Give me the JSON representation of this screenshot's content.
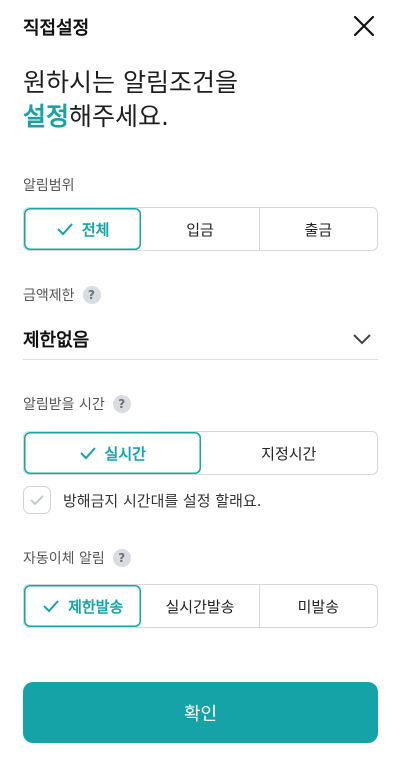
{
  "header": {
    "title": "직접설정"
  },
  "headline": {
    "line1": "원하시는 알림조건을",
    "accent": "설정",
    "line2_rest": "해주세요."
  },
  "alert_scope": {
    "label": "알림범위",
    "options": [
      {
        "label": "전체",
        "selected": true
      },
      {
        "label": "입금",
        "selected": false
      },
      {
        "label": "출금",
        "selected": false
      }
    ]
  },
  "amount_limit": {
    "label": "금액제한",
    "help": "?",
    "value": "제한없음"
  },
  "alert_time": {
    "label": "알림받을 시간",
    "help": "?",
    "options": [
      {
        "label": "실시간",
        "selected": true
      },
      {
        "label": "지정시간",
        "selected": false
      }
    ]
  },
  "do_not_disturb": {
    "label": "방해금지 시간대를 설정 할래요.",
    "checked": false
  },
  "auto_transfer": {
    "label": "자동이체 알림",
    "help": "?",
    "options": [
      {
        "label": "제한발송",
        "selected": true
      },
      {
        "label": "실시간발송",
        "selected": false
      },
      {
        "label": "미발송",
        "selected": false
      }
    ]
  },
  "confirm": {
    "label": "확인"
  },
  "colors": {
    "accent": "#15a3a8",
    "border": "#d5d9dd",
    "text": "#222222"
  }
}
